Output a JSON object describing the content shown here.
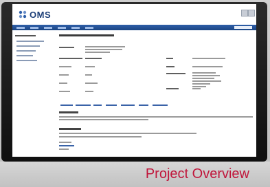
{
  "app": {
    "logo_text": "OMS"
  },
  "caption": "Project Overview",
  "colors": {
    "caption": "#c0163b",
    "navbar": "#1c4584",
    "logo": "#1d3f78"
  }
}
